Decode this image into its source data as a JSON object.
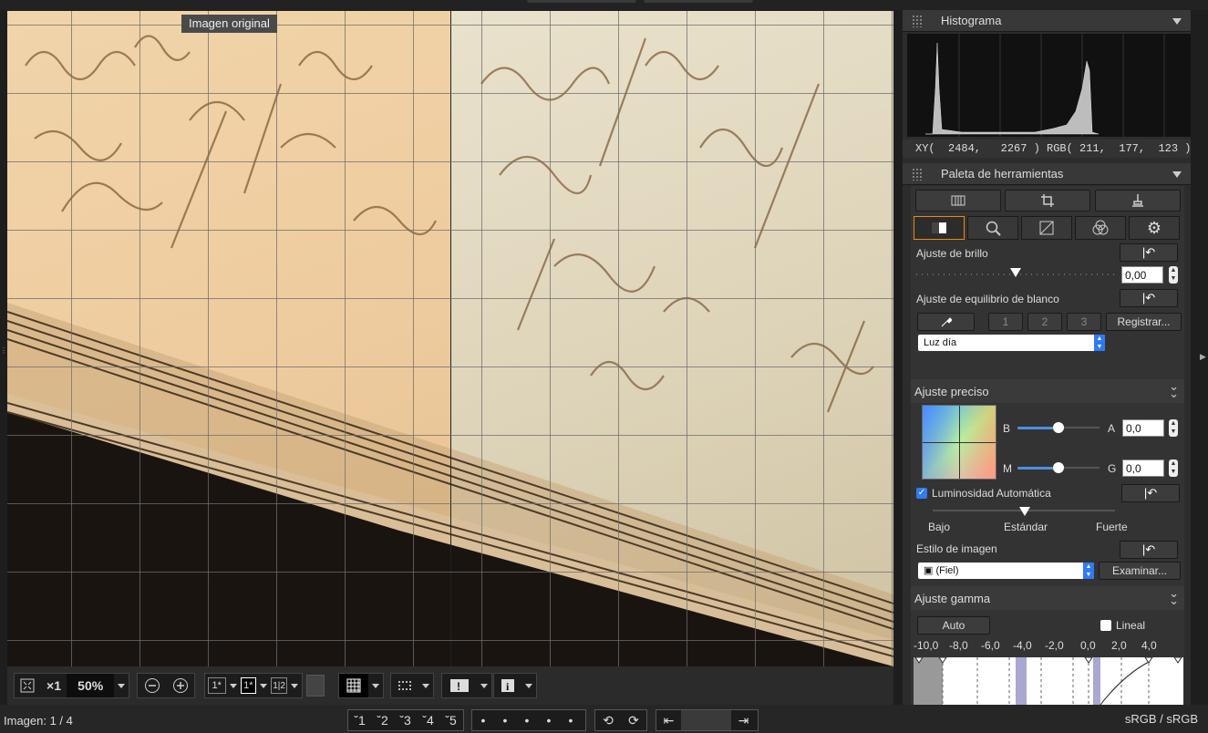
{
  "viewer": {
    "original_label": "Imagen original"
  },
  "toolbar": {
    "fit_icon": "fit-screen-icon",
    "x1_label": "×1",
    "zoom_value": "50%",
    "zoom_out_icon": "zoom-out-icon",
    "zoom_in_icon": "zoom-in-icon",
    "view1_label": "1*",
    "view2_label": "1*",
    "view3_label": "1|2",
    "grid_icon": "grid-icon",
    "af_icon": "af-points-icon",
    "highlight_icon": "highlight-warning-icon",
    "info_icon": "info-icon"
  },
  "status": {
    "image_counter": "Imagen: 1 / 4",
    "profile": "sRGB / sRGB",
    "ratings": [
      "1",
      "2",
      "3",
      "4",
      "5"
    ],
    "dots": [
      "•",
      "•",
      "•",
      "•",
      "•"
    ]
  },
  "histogram": {
    "title": "Histograma",
    "xy_readout": "XY(  2484,   2267 ) RGB( 211,  177,  123 )"
  },
  "tool_palette": {
    "title": "Paleta de herramientas",
    "brightness_label": "Ajuste de brillo",
    "brightness_value": "0,00",
    "brightness_level": 0.5,
    "wb_label": "Ajuste de equilibrio de blanco",
    "wb_preset_buttons": [
      "1",
      "2",
      "3"
    ],
    "register_label": "Registrar...",
    "wb_select": "Luz día"
  },
  "fine_adjust": {
    "title": "Ajuste preciso",
    "b_label": "B",
    "a_label": "A",
    "ba_value": "0,0",
    "m_label": "M",
    "g_label": "G",
    "mg_value": "0,0",
    "auto_lum_label": "Luminosidad Automática",
    "auto_lum_checked": true,
    "lum_low": "Bajo",
    "lum_std": "Estándar",
    "lum_strong": "Fuerte",
    "style_label": "Estilo de imagen",
    "style_select": "(Fiel)",
    "browse_label": "Examinar..."
  },
  "gamma": {
    "title": "Ajuste gamma",
    "auto_label": "Auto",
    "linear_label": "Lineal",
    "linear_checked": false,
    "scale": [
      "-10,0",
      "-8,0",
      "-6,0",
      "-4,0",
      "-2,0",
      "0,0",
      "2,0",
      "4,0"
    ]
  },
  "colors": {
    "accent": "#4a90e2",
    "tab_active": "#e98a16"
  }
}
